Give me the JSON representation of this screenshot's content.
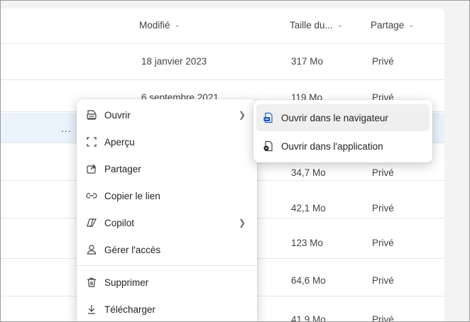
{
  "columns": {
    "modified": "Modifié",
    "size": "Taille du...",
    "sharing": "Partage"
  },
  "rows": [
    {
      "date": "18 janvier 2023",
      "size": "317 Mo",
      "sharing": "Privé"
    },
    {
      "date": "6 septembre 2021",
      "size": "119 Mo",
      "sharing": "Privé"
    },
    {
      "date": "",
      "size": "",
      "sharing": "",
      "more": "..."
    },
    {
      "date": "",
      "size": "34,7 Mo",
      "sharing": "Privé"
    },
    {
      "date": "",
      "size": "42,1 Mo",
      "sharing": "Privé"
    },
    {
      "date": "",
      "size": "123 Mo",
      "sharing": "Privé"
    },
    {
      "date": "",
      "size": "64,6 Mo",
      "sharing": "Privé"
    },
    {
      "date": "",
      "size": "41,9 Mo",
      "sharing": "Privé"
    }
  ],
  "context_menu": {
    "items": [
      {
        "label": "Ouvrir",
        "icon": "open-icon",
        "has_submenu": true
      },
      {
        "label": "Aperçu",
        "icon": "preview-icon",
        "has_submenu": false
      },
      {
        "label": "Partager",
        "icon": "share-icon",
        "has_submenu": false
      },
      {
        "label": "Copier le lien",
        "icon": "link-icon",
        "has_submenu": false
      },
      {
        "label": "Copilot",
        "icon": "copilot-icon",
        "has_submenu": true
      },
      {
        "label": "Gérer l'accès",
        "icon": "person-icon",
        "has_submenu": false
      },
      {
        "label": "Supprimer",
        "icon": "trash-icon",
        "has_submenu": false
      },
      {
        "label": "Télécharger",
        "icon": "download-icon",
        "has_submenu": false
      }
    ]
  },
  "submenu": {
    "items": [
      {
        "label": "Ouvrir dans le navigateur",
        "icon": "browser-doc-icon"
      },
      {
        "label": "Ouvrir dans l'application",
        "icon": "app-doc-icon"
      }
    ]
  },
  "colors": {
    "selected_row": "#eaf2fb",
    "accent": "#185abd",
    "background": "#f3f3f3"
  }
}
